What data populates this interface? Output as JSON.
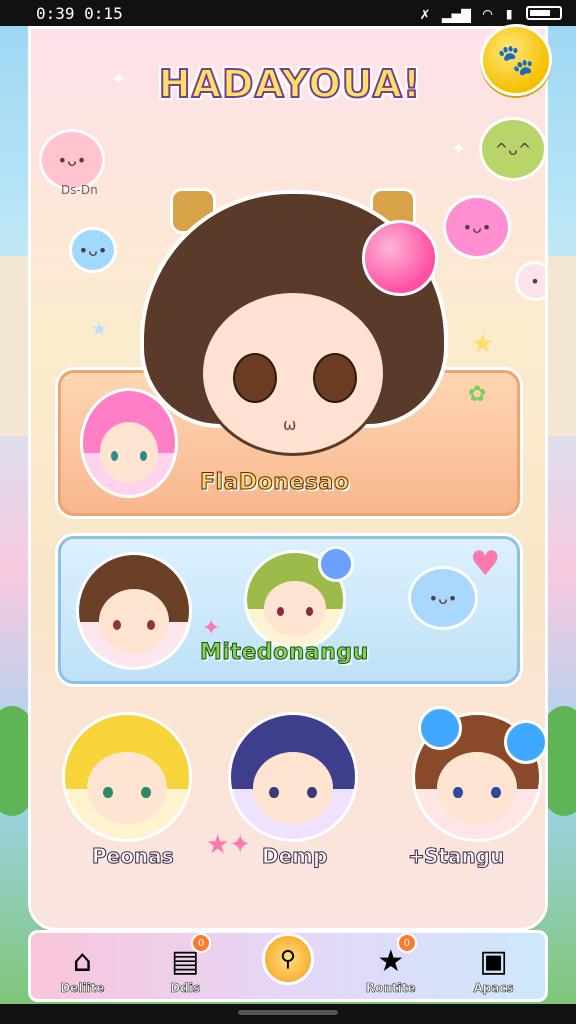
{
  "status_bar": {
    "time": "0:39 0:15",
    "icons": [
      "no-sim-icon",
      "signal-icon",
      "wifi-icon",
      "sd-card-icon",
      "battery-icon"
    ]
  },
  "header": {
    "title": "HADAYOUA!",
    "coin_icon": "paw-coin-icon"
  },
  "critters": {
    "top_left_label": "Ds-Dn"
  },
  "cards": [
    {
      "label": "FlaDonesao",
      "color": "#f7b78e"
    },
    {
      "label": "Mitedonangu",
      "color": "#bfe1f6"
    }
  ],
  "characters_row": [
    {
      "label": "Peonas"
    },
    {
      "label": "Demp"
    },
    {
      "label": "Stangu"
    }
  ],
  "bottom_nav": {
    "items": [
      {
        "label": "Deliite",
        "icon": "house-icon",
        "badge": ""
      },
      {
        "label": "Ddis",
        "icon": "card-icon",
        "badge": "0"
      },
      {
        "label": "",
        "icon": "search-icon",
        "badge": ""
      },
      {
        "label": "Rontite",
        "icon": "star-icon",
        "badge": "0"
      },
      {
        "label": "Apacs",
        "icon": "app-icon",
        "badge": ""
      }
    ]
  },
  "colors": {
    "accent": "#ff4fa2",
    "title_stroke": "#7a3e8c",
    "coin": "#f5c000"
  }
}
